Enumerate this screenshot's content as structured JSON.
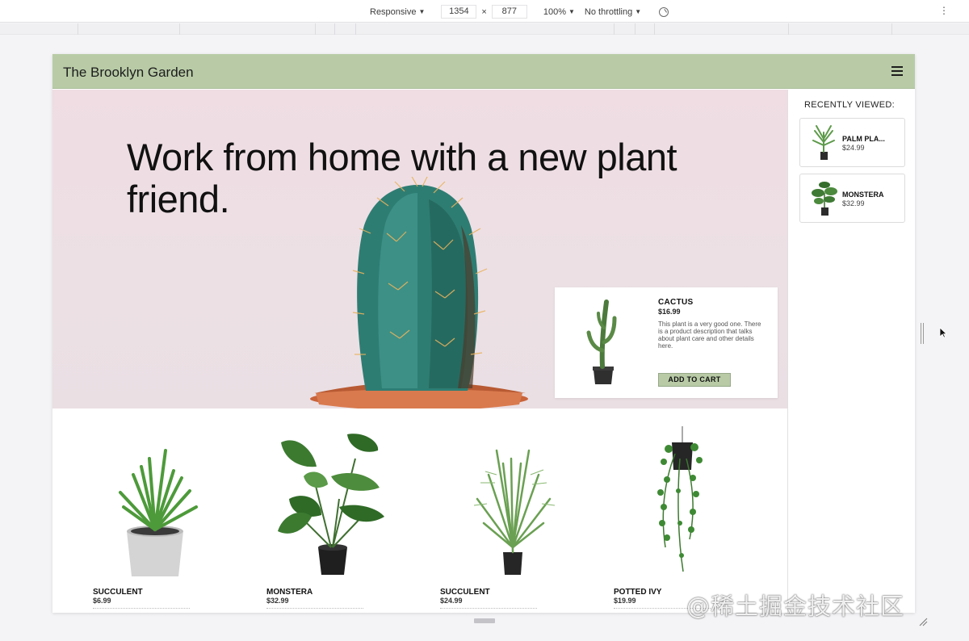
{
  "devtools": {
    "device_label": "Responsive",
    "width_value": "1354",
    "times_sign": "×",
    "height_value": "877",
    "zoom_label": "100%",
    "throttle_label": "No throttling",
    "more_label": "⋮"
  },
  "site": {
    "title": "The Brooklyn Garden",
    "header_color": "#b8cba6"
  },
  "hero": {
    "headline": "Work from home with a new plant friend."
  },
  "featured_product": {
    "name": "CACTUS",
    "price": "$16.99",
    "description": "This plant is a very good one. There is a product description that talks about plant care and other details here.",
    "button_label": "ADD TO CART"
  },
  "sidebar": {
    "title": "RECENTLY VIEWED:",
    "items": [
      {
        "name": "PALM PLA...",
        "price": "$24.99",
        "icon": "palm-plant"
      },
      {
        "name": "MONSTERA",
        "price": "$32.99",
        "icon": "monstera-plant"
      }
    ]
  },
  "products": [
    {
      "name": "SUCCULENT",
      "price": "$6.99",
      "icon": "succulent-plant"
    },
    {
      "name": "MONSTERA",
      "price": "$32.99",
      "icon": "monstera-plant"
    },
    {
      "name": "SUCCULENT",
      "price": "$24.99",
      "icon": "palm-plant"
    },
    {
      "name": "POTTED IVY",
      "price": "$19.99",
      "icon": "ivy-plant"
    }
  ],
  "watermark": "@稀土掘金技术社区"
}
